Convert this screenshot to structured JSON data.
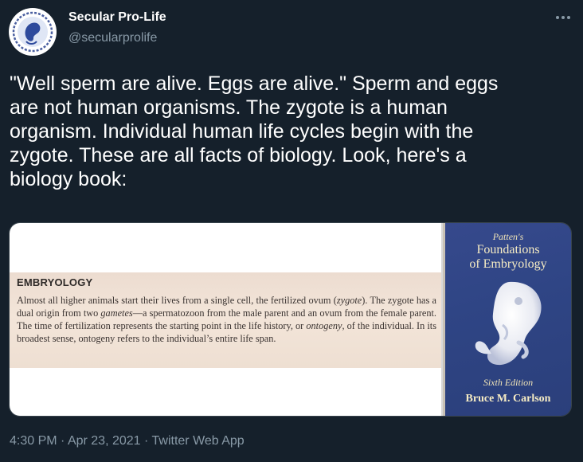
{
  "author": {
    "display_name": "Secular Pro-Life",
    "handle": "@secularprolife",
    "avatar_icon": "embryo-logo-icon"
  },
  "more_icon": "more-horizontal-icon",
  "tweet": {
    "text": "\"Well sperm are alive. Eggs are alive.\" Sperm and eggs\nare not human organisms. The zygote is a human\norganism. Individual human life cycles begin with the\nzygote. These are all facts of biology. Look, here's a\nbiology book:"
  },
  "media": {
    "page": {
      "heading": "EMBRYOLOGY",
      "body_parts": [
        "Almost all higher animals start their lives from a single cell, the fertilized ovum (",
        "zygote",
        "). The zygote has a dual origin from two ",
        "gametes",
        "—a spermatozoon from the male parent and an ovum from the female parent. The time of fertilization represents the starting point in the life history, or ",
        "ontogeny",
        ", of the individual. In its broadest sense, ontogeny refers to the individual’s entire life span."
      ]
    },
    "book": {
      "subtitle": "Patten's",
      "title_line1": "Foundations",
      "title_line2": "of Embryology",
      "edition": "Sixth Edition",
      "author": "Bruce M. Carlson",
      "cover_color": "#2f4585",
      "title_color": "#f6ecc4"
    }
  },
  "footer": {
    "time": "4:30 PM",
    "separator": "·",
    "date": "Apr 23, 2021",
    "source": "Twitter Web App"
  },
  "colors": {
    "background": "#15202b",
    "text": "#ffffff",
    "secondary": "#8899a6",
    "border": "#38444d"
  }
}
